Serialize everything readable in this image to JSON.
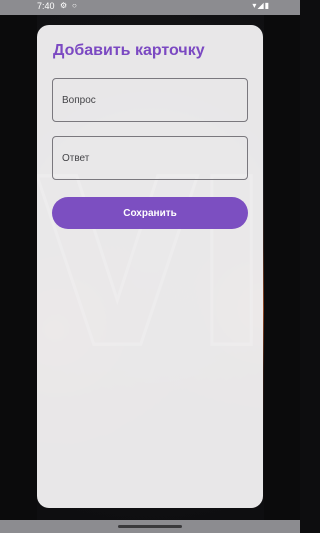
{
  "status_bar": {
    "time": "7:40",
    "left_icons": [
      "settings-icon",
      "circle-icon"
    ],
    "right_icons": [
      "wifi-icon",
      "signal-icon",
      "battery-icon"
    ]
  },
  "dialog": {
    "title": "Добавить карточку",
    "question_placeholder": "Вопрос",
    "question_value": "",
    "answer_placeholder": "Ответ",
    "answer_value": "",
    "save_label": "Сохранить"
  },
  "colors": {
    "accent": "#7c4fc1",
    "title": "#7b49c2",
    "dialog_bg": "#f0eef0",
    "field_border": "#7a787e"
  }
}
